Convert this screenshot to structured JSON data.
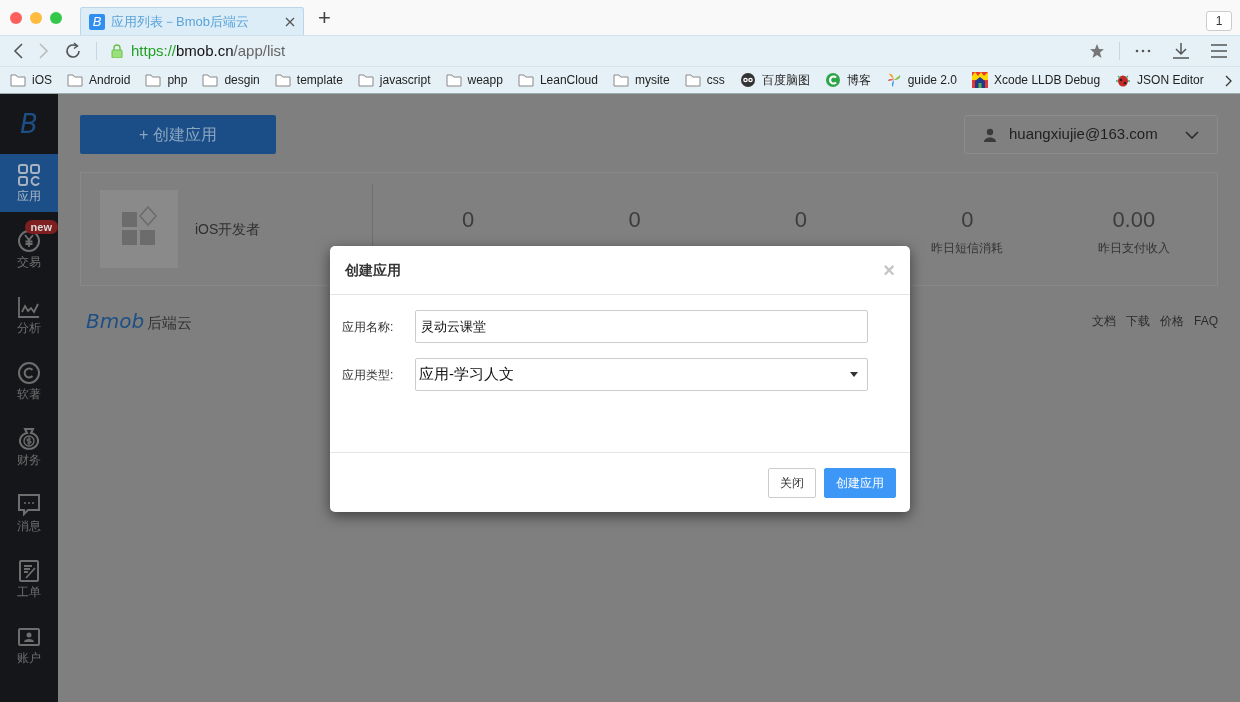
{
  "browser": {
    "tab": {
      "title": "应用列表－Bmob后端云",
      "favicon": "B",
      "selected": true
    },
    "new_tab": "+",
    "window_count": "1",
    "url": {
      "scheme": "https://",
      "host": "bmob.cn",
      "path": "/app/list"
    },
    "bookmarks": [
      {
        "kind": "folder",
        "label": "iOS"
      },
      {
        "kind": "folder",
        "label": "Android"
      },
      {
        "kind": "folder",
        "label": "php"
      },
      {
        "kind": "folder",
        "label": "desgin"
      },
      {
        "kind": "folder",
        "label": "template"
      },
      {
        "kind": "folder",
        "label": "javascript"
      },
      {
        "kind": "folder",
        "label": "weapp"
      },
      {
        "kind": "folder",
        "label": "LeanCloud"
      },
      {
        "kind": "folder",
        "label": "mysite"
      },
      {
        "kind": "folder",
        "label": "css"
      },
      {
        "kind": "owl",
        "label": "百度脑图"
      },
      {
        "kind": "c-logo",
        "label": "博客"
      },
      {
        "kind": "pinwheel",
        "label": "guide 2.0"
      },
      {
        "kind": "house",
        "label": "Xcode LLDB Debug"
      },
      {
        "kind": "bug",
        "label": "JSON Editor"
      }
    ]
  },
  "sidebar": {
    "logo": "B",
    "items": [
      {
        "kind": "apps",
        "label": "应用",
        "selected": true
      },
      {
        "kind": "yen",
        "label": "交易",
        "selected": false,
        "badge": "new"
      },
      {
        "kind": "chart",
        "label": "分析",
        "selected": false
      },
      {
        "kind": "copyright",
        "label": "软著",
        "selected": false
      },
      {
        "kind": "bag",
        "label": "财务",
        "selected": false
      },
      {
        "kind": "message",
        "label": "消息",
        "selected": false
      },
      {
        "kind": "edit",
        "label": "工单",
        "selected": false
      },
      {
        "kind": "account",
        "label": "账户",
        "selected": false
      }
    ]
  },
  "create_button": "+ 创建应用",
  "account": {
    "email": "huangxiujie@163.com"
  },
  "app_card": {
    "name": "iOS开发者",
    "stats": [
      {
        "value": "0"
      },
      {
        "value": "0"
      },
      {
        "value": "0"
      },
      {
        "value": "0",
        "label": "昨日短信消耗"
      },
      {
        "value": "0.00",
        "label": "昨日支付收入"
      }
    ]
  },
  "footer": {
    "brand": "Bmob",
    "brand_suffix": "后端云",
    "links": [
      "文档",
      "下载",
      "价格",
      "FAQ"
    ]
  },
  "dialog": {
    "title": "创建应用",
    "close": "×",
    "fields": [
      {
        "kind": "text",
        "label": "应用名称:",
        "value": "灵动云课堂"
      },
      {
        "kind": "select",
        "label": "应用类型:",
        "value": "应用-学习人文"
      }
    ],
    "buttons": [
      {
        "kind": "default",
        "label": "关闭"
      },
      {
        "kind": "primary",
        "label": "创建应用"
      }
    ]
  }
}
